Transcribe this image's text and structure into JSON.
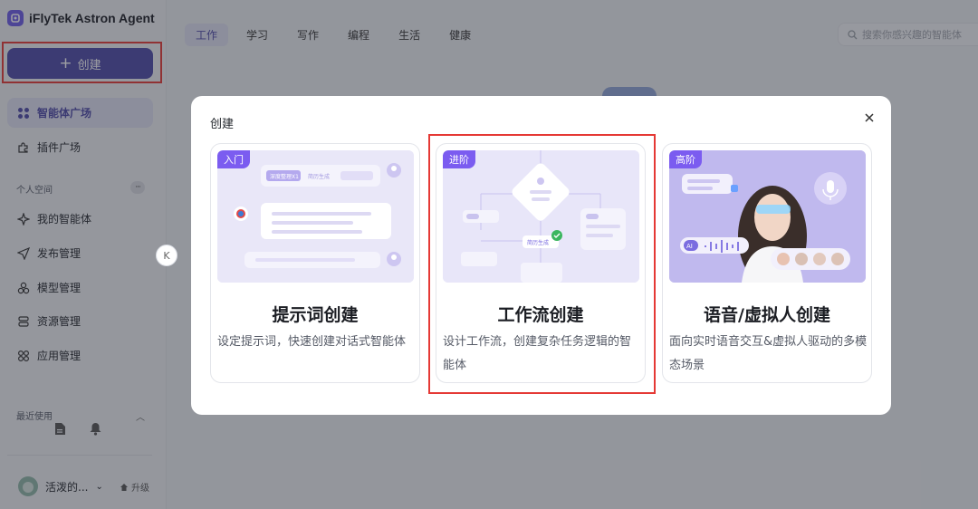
{
  "app": {
    "brand": "iFlyTek Astron Agent"
  },
  "sidebar": {
    "create_label": "创建",
    "nav": [
      {
        "label": "智能体广场",
        "icon": "grid-icon"
      },
      {
        "label": "插件广场",
        "icon": "plugin-icon"
      }
    ],
    "personal_label": "个人空间",
    "more_label": "···",
    "personal_nav": [
      {
        "label": "我的智能体",
        "icon": "sparkle-icon"
      },
      {
        "label": "发布管理",
        "icon": "send-icon"
      },
      {
        "label": "模型管理",
        "icon": "model-icon"
      },
      {
        "label": "资源管理",
        "icon": "resource-icon"
      },
      {
        "label": "应用管理",
        "icon": "app-icon"
      }
    ],
    "recent_label": "最近使用",
    "user_name": "活泼的...",
    "upgrade_label": "升级",
    "collapse_glyph": "K"
  },
  "main": {
    "tabs": [
      "工作",
      "学习",
      "写作",
      "编程",
      "生活",
      "健康"
    ],
    "active_tab": "工作",
    "search_placeholder": "搜索你感兴趣的智能体"
  },
  "modal": {
    "title": "创建",
    "close_icon": "close-icon",
    "cards": [
      {
        "badge": "入门",
        "title": "提示词创建",
        "desc": "设定提示词，快速创建对话式智能体",
        "illustration_text": [
          "深度整理X1",
          "简历生成"
        ]
      },
      {
        "badge": "进阶",
        "title": "工作流创建",
        "desc": "设计工作流，创建复杂任务逻辑的智能体",
        "illustration_text": [
          "简历生成"
        ]
      },
      {
        "badge": "高阶",
        "title": "语音/虚拟人创建",
        "desc": "面向实时语音交互&虚拟人驱动的多模态场景",
        "illustration_text": [
          "AI"
        ]
      }
    ]
  },
  "colors": {
    "accent": "#4e4aa8",
    "badge": "#7b5cf0",
    "highlight": "#e53935"
  }
}
